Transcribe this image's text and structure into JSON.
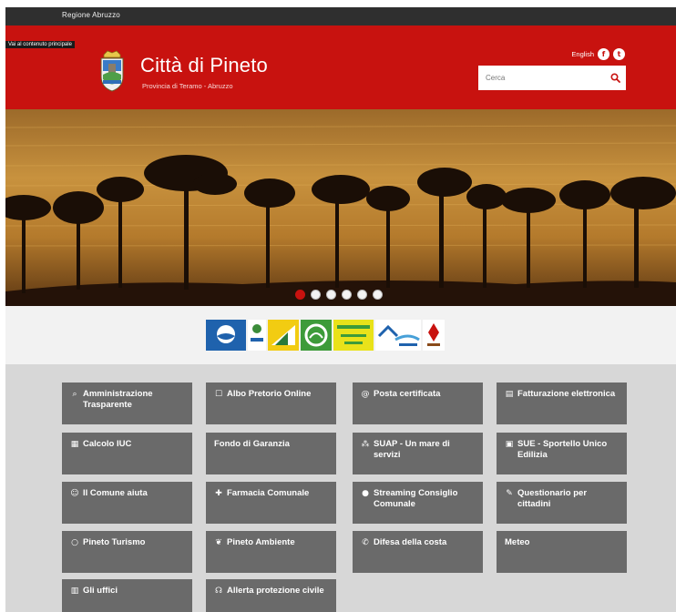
{
  "topbar": {
    "link": "Regione Abruzzo"
  },
  "header": {
    "skip_link": "Vai al contenuto principale",
    "title": "Città di Pineto",
    "subtitle": "Provincia di Teramo - Abruzzo",
    "lang": "English",
    "social": [
      {
        "icon": "facebook-icon",
        "glyph": "f"
      },
      {
        "icon": "twitter-icon",
        "glyph": "t"
      }
    ],
    "search": {
      "placeholder": "Cerca"
    }
  },
  "hero": {
    "slides": 6,
    "active": 1
  },
  "logos": [
    {
      "name": "bandiera-blu-logo",
      "bg": "#1f62ad"
    },
    {
      "name": "spiagge-logo",
      "bg": "#ffffff"
    },
    {
      "name": "vela-logo",
      "bg": "#f2cc12"
    },
    {
      "name": "legambiente-logo",
      "bg": "#3d9b3a"
    },
    {
      "name": "plastic-free-logo",
      "bg": "#e9e21a"
    },
    {
      "name": "comuni-ricicloni-logo",
      "bg": "#ffffff"
    },
    {
      "name": "premio-logo",
      "bg": "#ffffff"
    }
  ],
  "colors": {
    "primary": "#c8120f",
    "tile": "#6a6a6a",
    "grid_bg": "#d7d7d7"
  },
  "tiles": [
    {
      "icon": "search-icon",
      "glyph": "⌕",
      "label": "Amministrazione Trasparente"
    },
    {
      "icon": "document-icon",
      "glyph": "☐",
      "label": "Albo Pretorio Online"
    },
    {
      "icon": "at-icon",
      "glyph": "@",
      "label": "Posta certificata"
    },
    {
      "icon": "invoice-icon",
      "glyph": "▤",
      "label": "Fatturazione elettronica"
    },
    {
      "icon": "calculator-icon",
      "glyph": "▦",
      "label": "Calcolo IUC"
    },
    {
      "icon": "",
      "glyph": "",
      "label": "Fondo di Garanzia"
    },
    {
      "icon": "link-icon",
      "glyph": "⁂",
      "label": "SUAP - Un mare di servizi"
    },
    {
      "icon": "building-icon",
      "glyph": "▣",
      "label": "SUE - Sportello Unico Edilizia"
    },
    {
      "icon": "people-icon",
      "glyph": "☺",
      "label": "Il Comune aiuta"
    },
    {
      "icon": "plus-icon",
      "glyph": "✚",
      "label": "Farmacia Comunale"
    },
    {
      "icon": "record-icon",
      "glyph": "●",
      "label": "Streaming Consiglio Comunale"
    },
    {
      "icon": "survey-icon",
      "glyph": "✎",
      "label": "Questionario per cittadini"
    },
    {
      "icon": "compass-icon",
      "glyph": "○",
      "label": "Pineto Turismo"
    },
    {
      "icon": "leaf-icon",
      "glyph": "❦",
      "label": "Pineto Ambiente"
    },
    {
      "icon": "phone-icon",
      "glyph": "✆",
      "label": "Difesa della costa"
    },
    {
      "icon": "",
      "glyph": "",
      "label": "Meteo"
    },
    {
      "icon": "office-icon",
      "glyph": "▥",
      "label": "Gli uffici"
    },
    {
      "icon": "signal-icon",
      "glyph": "☊",
      "label": "Allerta protezione civile"
    }
  ]
}
